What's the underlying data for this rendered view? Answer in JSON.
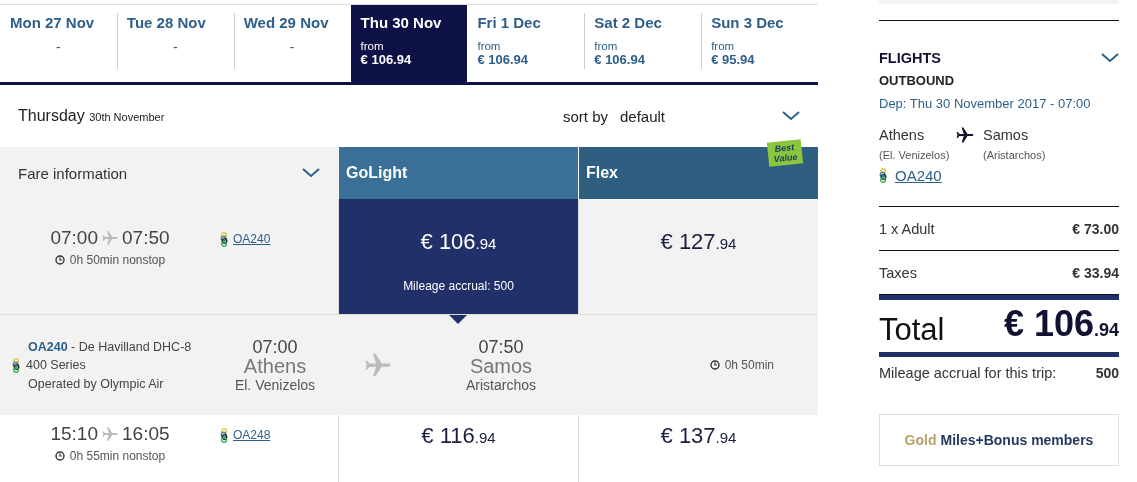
{
  "date_tabs": [
    {
      "day": "Mon 27 Nov",
      "price": "-",
      "selected": false
    },
    {
      "day": "Tue 28 Nov",
      "price": "-",
      "selected": false
    },
    {
      "day": "Wed 29 Nov",
      "price": "-",
      "selected": false
    },
    {
      "day": "Thu 30 Nov",
      "from": "from",
      "price": "€ 106.94",
      "selected": true
    },
    {
      "day": "Fri 1 Dec",
      "from": "from",
      "price": "€ 106.94",
      "selected": false
    },
    {
      "day": "Sat 2 Dec",
      "from": "from",
      "price": "€ 106.94",
      "selected": false
    },
    {
      "day": "Sun 3 Dec",
      "from": "from",
      "price": "€ 95.94",
      "selected": false
    }
  ],
  "day_header": {
    "weekday": "Thursday",
    "date": "30th November",
    "sort_label": "sort by",
    "sort_value": "default"
  },
  "fare_header": {
    "info_label": "Fare information",
    "columns": [
      {
        "name": "GoLight"
      },
      {
        "name": "Flex",
        "badge": "Best Value"
      }
    ]
  },
  "flights": [
    {
      "depart": "07:00",
      "arrive": "07:50",
      "duration": "0h 50min nonstop",
      "flight": "OA240",
      "expanded": true,
      "fares": [
        {
          "whole": "€ 106",
          "cents": ".94",
          "selected": true,
          "mileage": "Mileage accrual: 500"
        },
        {
          "whole": "€ 127",
          "cents": ".94",
          "selected": false
        }
      ],
      "details": {
        "flight": "OA240",
        "aircraft": " - De Havilland DHC-8",
        "series": "400 Series",
        "operator": "Operated by Olympic Air",
        "dep_time": "07:00",
        "dep_city": "Athens",
        "dep_airport": "El. Venizelos",
        "arr_time": "07:50",
        "arr_city": "Samos",
        "arr_airport": "Aristarchos",
        "duration": "0h 50min"
      }
    },
    {
      "depart": "15:10",
      "arrive": "16:05",
      "duration": "0h 55min nonstop",
      "flight": "OA248",
      "expanded": false,
      "fares": [
        {
          "whole": "€ 116",
          "cents": ".94",
          "selected": false
        },
        {
          "whole": "€ 137",
          "cents": ".94",
          "selected": false
        }
      ]
    }
  ],
  "summary": {
    "title": "FLIGHTS",
    "direction": "OUTBOUND",
    "departure": "Dep: Thu 30 November 2017 - 07:00",
    "from_city": "Athens",
    "from_airport": "(El. Venizelos)",
    "to_city": "Samos",
    "to_airport": "(Aristarchos)",
    "flight": "OA240",
    "lines": [
      {
        "label": "1 x Adult",
        "amount": "€ 73.00"
      },
      {
        "label": "Taxes",
        "amount": "€ 33.94"
      }
    ],
    "total_label": "Total",
    "total_whole": "€ 106",
    "total_cents": ".94",
    "mileage_label": "Mileage accrual for this trip:",
    "mileage": "500"
  },
  "promo": {
    "tier": "Gold",
    "text": "Miles+Bonus members"
  }
}
